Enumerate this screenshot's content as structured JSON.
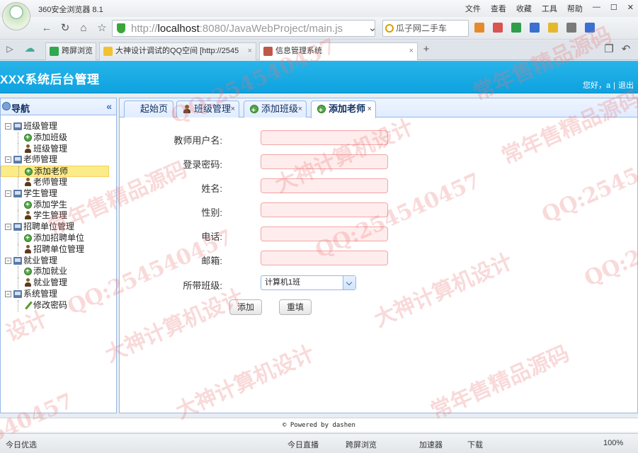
{
  "browser": {
    "name": "360安全浏览器 8.1",
    "menu": [
      "文件",
      "查看",
      "收藏",
      "工具",
      "帮助"
    ],
    "url_host": "http://",
    "url_domain": "localhost",
    "url_path": ":8080/JavaWebProject/main.js",
    "search_text": "瓜子网二手车",
    "tabs": [
      {
        "label": "跨屏浏览"
      },
      {
        "label": "大神设计调试的QQ空间 [http://2545"
      },
      {
        "label": "信息管理系统"
      }
    ],
    "status": {
      "left": "今日优选",
      "live": "今日直播",
      "cross": "跨屏浏览",
      "speed": "加速器",
      "download": "下载",
      "zoom": "100%"
    }
  },
  "app": {
    "title": "XXX系统后台管理",
    "greeting": "您好，a",
    "separator": "|",
    "logout": "退出"
  },
  "nav": {
    "title": "导航",
    "collapse": "«",
    "groups": [
      {
        "label": "班级管理",
        "items": [
          {
            "label": "添加班级",
            "icon": "add"
          },
          {
            "label": "班级管理",
            "icon": "user"
          }
        ]
      },
      {
        "label": "老师管理",
        "items": [
          {
            "label": "添加老师",
            "icon": "add",
            "selected": true
          },
          {
            "label": "老师管理",
            "icon": "user"
          }
        ]
      },
      {
        "label": "学生管理",
        "items": [
          {
            "label": "添加学生",
            "icon": "add"
          },
          {
            "label": "学生管理",
            "icon": "user"
          }
        ]
      },
      {
        "label": "招聘单位管理",
        "items": [
          {
            "label": "添加招聘单位",
            "icon": "add"
          },
          {
            "label": "招聘单位管理",
            "icon": "user"
          }
        ]
      },
      {
        "label": "就业管理",
        "items": [
          {
            "label": "添加就业",
            "icon": "add"
          },
          {
            "label": "就业管理",
            "icon": "user"
          }
        ]
      },
      {
        "label": "系统管理",
        "items": [
          {
            "label": "修改密码",
            "icon": "pen"
          }
        ]
      }
    ]
  },
  "tabs": [
    {
      "label": "起始页"
    },
    {
      "label": "班级管理",
      "close": "×"
    },
    {
      "label": "添加班级",
      "close": "×"
    },
    {
      "label": "添加老师",
      "close": "×",
      "active": true
    }
  ],
  "form": {
    "fields": [
      {
        "label": "教师用户名:",
        "value": ""
      },
      {
        "label": "登录密码:",
        "value": ""
      },
      {
        "label": "姓名:",
        "value": ""
      },
      {
        "label": "性别:",
        "value": ""
      },
      {
        "label": "电话:",
        "value": ""
      },
      {
        "label": "邮箱:",
        "value": ""
      }
    ],
    "class_label": "所带班级:",
    "class_value": "计算机1班",
    "submit": "添加",
    "reset": "重填"
  },
  "footer": {
    "text": "© Powered by dashen"
  },
  "watermarks": [
    "QQ:254540457",
    "大神计算机设计",
    "常年售精品源码",
    "QQ:254540457",
    "大神计算机设计",
    "常年售精品源码",
    "QQ:2545",
    "QQ:254540457",
    "大神计算机设计",
    "常年售精品源码",
    "540457",
    "QQ:254540457",
    "大神计算机设计",
    "常年售精品源码",
    "设计"
  ]
}
